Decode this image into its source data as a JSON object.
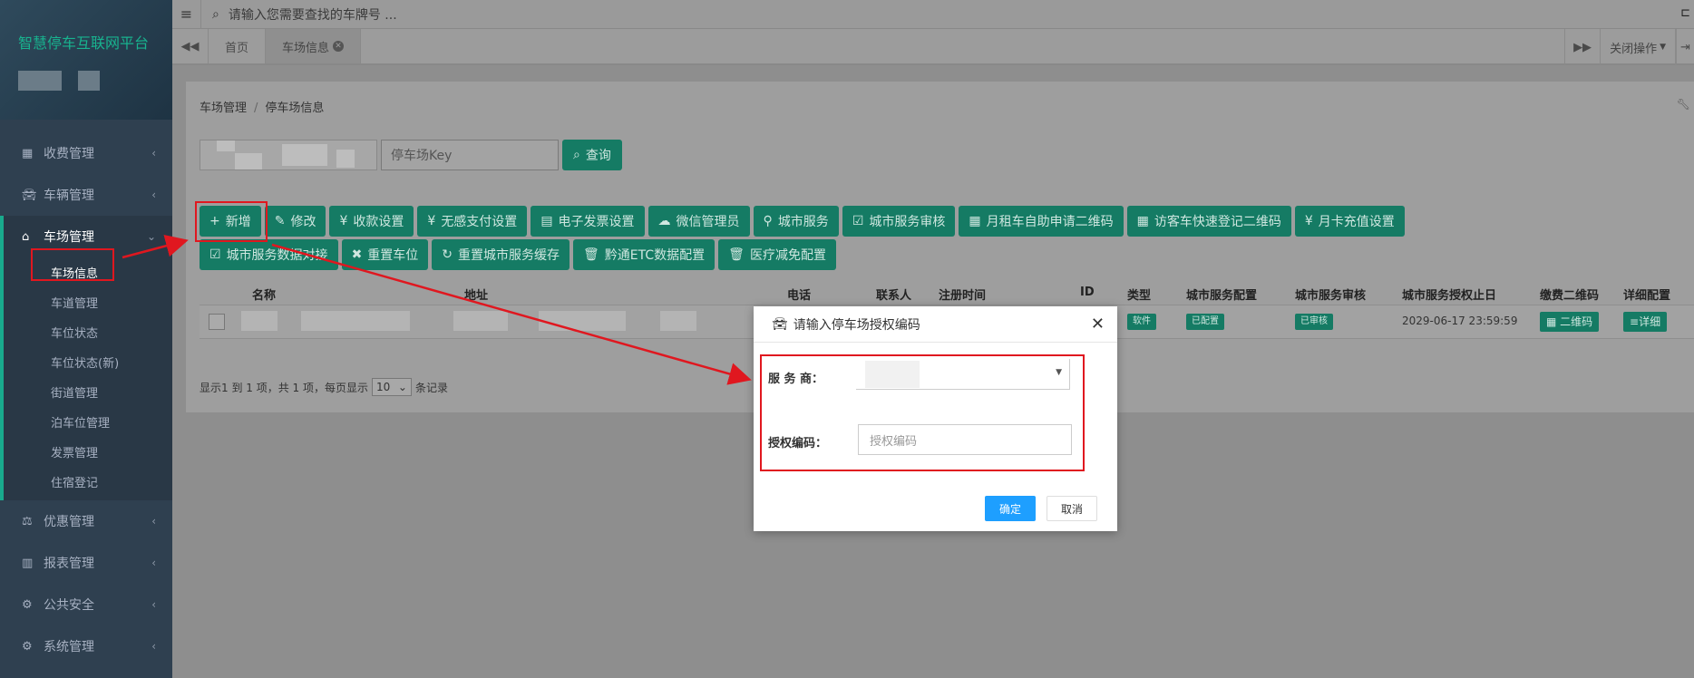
{
  "app": {
    "title": "智慧停车互联网平台"
  },
  "sidebar": {
    "items": [
      {
        "label": "收费管理",
        "icon": "grid-icon"
      },
      {
        "label": "车辆管理",
        "icon": "car-icon"
      },
      {
        "label": "车场管理",
        "icon": "building-icon",
        "active": true
      },
      {
        "label": "优惠管理",
        "icon": "scale-icon"
      },
      {
        "label": "报表管理",
        "icon": "bar-chart-icon"
      },
      {
        "label": "公共安全",
        "icon": "gears-icon"
      },
      {
        "label": "系统管理",
        "icon": "gears-icon"
      }
    ],
    "sub_items": [
      "车场信息",
      "车道管理",
      "车位状态",
      "车位状态(新)",
      "街道管理",
      "泊车位管理",
      "发票管理",
      "住宿登记"
    ]
  },
  "topbar": {
    "search_placeholder": "请输入您需要查找的车牌号 ..."
  },
  "tabs": {
    "items": [
      "首页",
      "车场信息"
    ],
    "close_ops": "关闭操作"
  },
  "breadcrumb": {
    "parent": "车场管理",
    "current": "停车场信息"
  },
  "filter": {
    "key_placeholder": "停车场Key",
    "query_label": "查询"
  },
  "toolbar": {
    "buttons": [
      {
        "label": "新增",
        "icon": "plus-icon"
      },
      {
        "label": "修改",
        "icon": "edit-icon"
      },
      {
        "label": "收款设置",
        "icon": "yen-icon"
      },
      {
        "label": "无感支付设置",
        "icon": "yen-icon"
      },
      {
        "label": "电子发票设置",
        "icon": "invoice-icon"
      },
      {
        "label": "微信管理员",
        "icon": "wechat-icon"
      },
      {
        "label": "城市服务",
        "icon": "map-marker-icon"
      },
      {
        "label": "城市服务审核",
        "icon": "check-square-icon"
      },
      {
        "label": "月租车自助申请二维码",
        "icon": "qrcode-icon"
      },
      {
        "label": "访客车快速登记二维码",
        "icon": "qrcode-icon"
      },
      {
        "label": "月卡充值设置",
        "icon": "yen-icon"
      },
      {
        "label": "城市服务数据对接",
        "icon": "check-square-icon"
      },
      {
        "label": "重置车位",
        "icon": "x-icon"
      },
      {
        "label": "重置城市服务缓存",
        "icon": "refresh-icon"
      },
      {
        "label": "黔通ETC数据配置",
        "icon": "trash-icon"
      },
      {
        "label": "医疗减免配置",
        "icon": "trash-icon"
      }
    ]
  },
  "table": {
    "headers": [
      "名称",
      "地址",
      "电话",
      "联系人",
      "注册时间",
      "ID",
      "类型",
      "城市服务配置",
      "城市服务审核",
      "城市服务授权止日",
      "缴费二维码",
      "详细配置"
    ],
    "row": {
      "type": "软件",
      "city_config": "已配置",
      "city_audit": "已审核",
      "expire": "2029-06-17 23:59:59",
      "qrcode_btn": "二维码",
      "detail_btn": "详细"
    }
  },
  "pager": {
    "summary": "显示1 到 1 项，共 1 项，每页显示",
    "page_size": "10",
    "suffix": "条记录"
  },
  "modal": {
    "title": "请输入停车场授权编码",
    "provider_label": "服 务 商：",
    "auth_label": "授权编码：",
    "auth_placeholder": "授权编码",
    "ok_label": "确定",
    "cancel_label": "取消"
  }
}
